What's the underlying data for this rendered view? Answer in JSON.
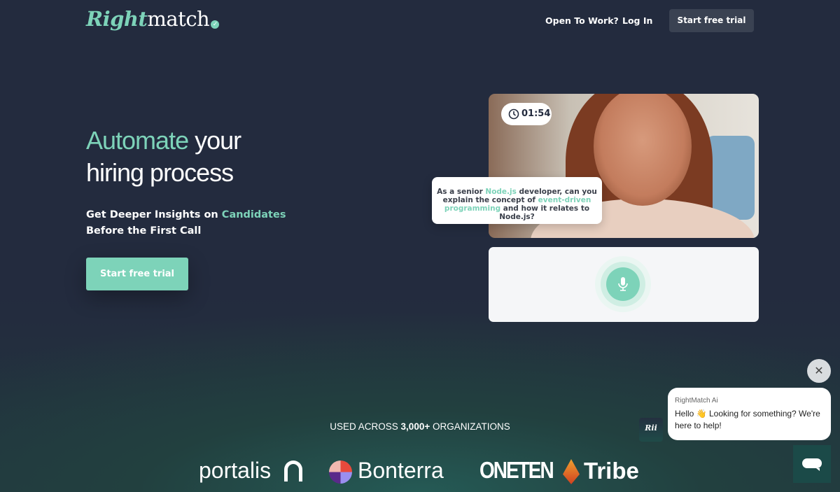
{
  "header": {
    "logo_bold": "Right",
    "logo_rest": "match",
    "nav": [
      "Open To Work?",
      "Log In"
    ],
    "cta": "Start free trial"
  },
  "hero": {
    "title_accent": "Automate",
    "title_rest1": " your",
    "title_line2": "hiring process",
    "sub_pre": "Get Deeper Insights on ",
    "sub_accent": "Candidates",
    "sub_post": " Before the First Call",
    "cta": "Start free trial"
  },
  "demo": {
    "timer": "01:54",
    "q1": "As a senior ",
    "q2": "Node.js",
    "q3": " developer, can you explain the concept of ",
    "q4": "event-driven programming",
    "q5": " and how it relates to Node.js?"
  },
  "social": {
    "pre": "USED ACROSS ",
    "num": "3,000+",
    "post": " ORGANIZATIONS",
    "logos": [
      "portalis",
      "Bonterra",
      "ONETEN",
      "Tribe"
    ]
  },
  "chat": {
    "name": "RightMatch Ai",
    "msg_pre": "Hello ",
    "emoji": "👋",
    "msg_post": " Looking for something? We're here to help!",
    "avatar": "Rii"
  },
  "colors": {
    "accent": "#7dd3b9",
    "bg": "#232b3e"
  }
}
